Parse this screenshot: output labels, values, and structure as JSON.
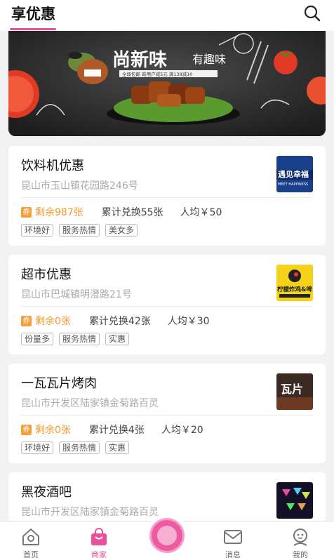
{
  "header": {
    "title": "享优惠"
  },
  "banner": {
    "headline_main": "尚新味",
    "headline_sub": "有趣味",
    "promo": "全场包邮 新用户减5元 满138减10"
  },
  "stores": [
    {
      "name": "饮料机优惠",
      "address": "昆山市玉山镇花园路246号",
      "coupon_icon": "券",
      "remaining": "剩余987张",
      "redeemed": "累计兑换55张",
      "avg_price": "人均￥50",
      "tags": [
        "环境好",
        "服务热情",
        "美女多"
      ],
      "thumb_text": "遇见幸福",
      "thumb_sub": "MEET HAPPINESS"
    },
    {
      "name": "超市优惠",
      "address": "昆山市巴城镇明澄路21号",
      "coupon_icon": "券",
      "remaining": "剩余0张",
      "redeemed": "累计兑换42张",
      "avg_price": "人均￥30",
      "tags": [
        "份量多",
        "服务热情",
        "实惠"
      ],
      "thumb_text": "柠檬炸鸡&啤"
    },
    {
      "name": "一瓦瓦片烤肉",
      "address": "昆山市开发区陆家镇金菊路百灵",
      "coupon_icon": "券",
      "remaining": "剩余0张",
      "redeemed": "累计兑换4张",
      "avg_price": "人均￥20",
      "tags": [
        "环境好",
        "服务热情",
        "实惠"
      ],
      "thumb_text": "瓦片"
    },
    {
      "name": "黑夜酒吧",
      "address": "昆山市开发区陆家镇金菊路百灵"
    }
  ],
  "tabbar": {
    "home": "首页",
    "merchant": "商家",
    "messages": "消息",
    "mine": "我的"
  },
  "colors": {
    "accent": "#e9529a",
    "coupon": "#f39a2e"
  }
}
